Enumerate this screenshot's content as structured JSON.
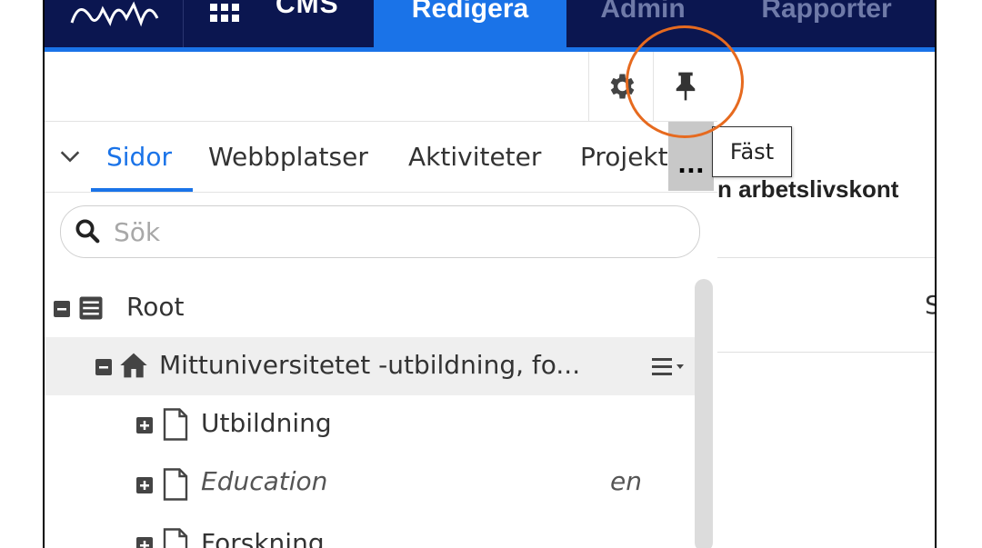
{
  "nav": {
    "product": "CMS",
    "tabs": [
      {
        "label": "Redigera",
        "active": true
      },
      {
        "label": "Admin",
        "active": false
      },
      {
        "label": "Rapporter",
        "active": false
      }
    ]
  },
  "gadget_tabs": {
    "items": [
      "Sidor",
      "Webbplatser",
      "Aktiviteter",
      "Projekt"
    ],
    "active": "Sidor",
    "more": "..."
  },
  "search": {
    "placeholder": "Sök"
  },
  "tree": [
    {
      "label": "Root",
      "icon": "list-icon",
      "expand": "minus"
    },
    {
      "label": "Mittuniversitetet -utbildning, fo...",
      "icon": "home-icon",
      "expand": "minus",
      "selected": true
    },
    {
      "label": "Utbildning",
      "icon": "page-icon",
      "expand": "plus"
    },
    {
      "label": "Education",
      "icon": "page-icon",
      "expand": "plus",
      "lang": "en",
      "italic": true
    },
    {
      "label": "Forskning",
      "icon": "page-icon",
      "expand": "plus"
    }
  ],
  "tooltip": "Fäst",
  "content": {
    "heading": "n arbetslivskont",
    "side_letter": "S"
  },
  "colors": {
    "nav_bg": "#0b1650",
    "accent": "#1a73e8",
    "highlight_circle": "#e66a1f"
  }
}
